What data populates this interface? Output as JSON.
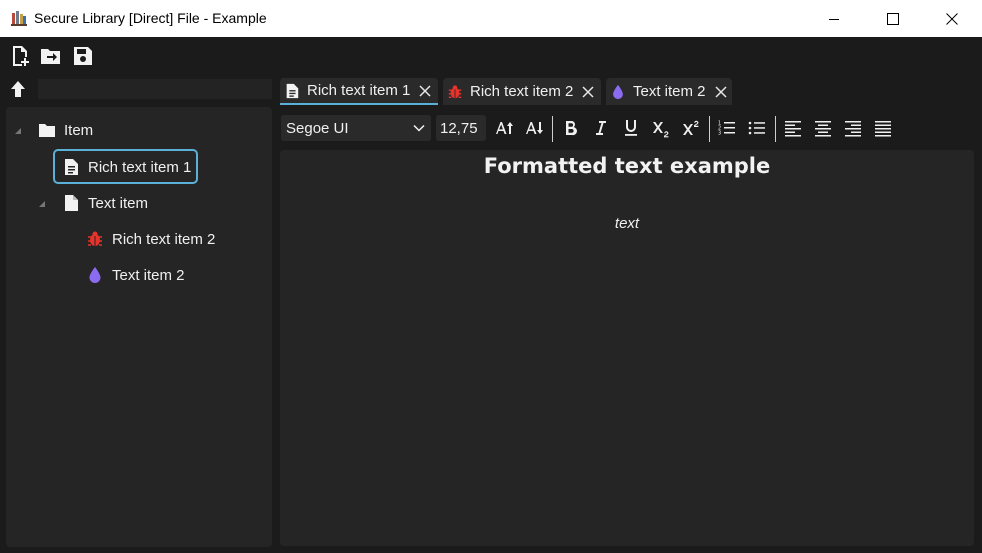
{
  "window": {
    "title": "Secure Library [Direct] File - Example"
  },
  "main_toolbar": {
    "icons": [
      "new-file-icon",
      "import-icon",
      "save-icon"
    ]
  },
  "navigation": {
    "up_icon": "arrow-up-icon",
    "path": ""
  },
  "tree": {
    "items": [
      {
        "label": "Item",
        "icon": "folder-icon",
        "level": 0,
        "expanded": true
      },
      {
        "label": "Rich text item 1",
        "icon": "rich-text-doc-icon",
        "level": 1,
        "selected": true
      },
      {
        "label": "Text item",
        "icon": "doc-icon",
        "level": 1,
        "expanded": true
      },
      {
        "label": "Rich text item 2",
        "icon": "bug-icon",
        "level": 2
      },
      {
        "label": "Text item 2",
        "icon": "drop-icon",
        "level": 2
      }
    ]
  },
  "tabs": [
    {
      "label": "Rich text item 1",
      "icon": "rich-text-doc-icon",
      "active": true
    },
    {
      "label": "Rich text item 2",
      "icon": "bug-icon",
      "active": false
    },
    {
      "label": "Text item 2",
      "icon": "drop-icon",
      "active": false
    }
  ],
  "format_toolbar": {
    "font_family": "Segoe UI",
    "font_size": "12,75",
    "buttons": [
      "increase-font-size",
      "decrease-font-size",
      "bold",
      "italic",
      "underline",
      "subscript",
      "superscript",
      "numbered-list",
      "bullet-list",
      "align-left",
      "align-center",
      "align-right",
      "justify"
    ]
  },
  "document": {
    "heading": "Formatted text example",
    "body": "text"
  },
  "colors": {
    "accent": "#5ab0d6",
    "bug": "#e8332b",
    "drop": "#8b6cf0",
    "background": "#1b1b1b",
    "panel": "#252525"
  }
}
